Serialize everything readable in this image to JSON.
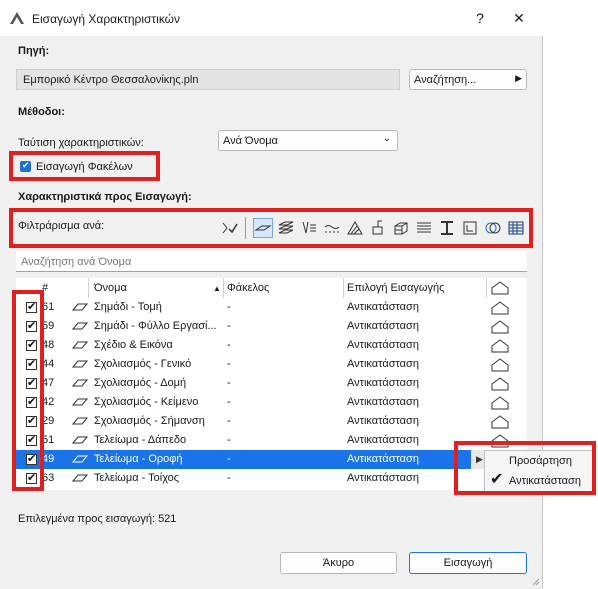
{
  "window": {
    "title": "Εισαγωγή Χαρακτηριστικών",
    "help": "?",
    "close": "✕"
  },
  "source": {
    "label": "Πηγή:",
    "file": "Εμπορικό Κέντρο Θεσσαλονίκης.pln",
    "browse_label": "Αναζήτηση..."
  },
  "methods": {
    "label": "Μέθοδοι:",
    "match_label": "Ταύτιση χαρακτηριστικών:",
    "match_value": "Ανά Όνομα",
    "import_folders_label": "Εισαγωγή Φακέλων",
    "import_folders_checked": true
  },
  "attributes": {
    "label": "Χαρακτηριστικά προς Εισαγωγή:",
    "filter_label": "Φιλτράρισμα ανά:",
    "filter_icons": [
      "select-all-filter-icon",
      "layers-icon",
      "layer-combinations-icon",
      "pens-icon",
      "line-types-icon",
      "fill-types-icon",
      "composites-icon",
      "building-materials-icon",
      "surfaces-icon",
      "profiles-icon",
      "zone-categories-icon",
      "mep-systems-icon",
      "operation-profiles-icon"
    ],
    "search_placeholder": "Αναζήτηση ανά Όνομα",
    "columns": {
      "num": "#",
      "name": "Όνομα",
      "folder": "Φάκελος",
      "choice": "Επιλογή Εισαγωγής"
    },
    "rows": [
      {
        "num": "61",
        "name": "Σημάδι - Τομή",
        "folder": "-",
        "choice": "Αντικατάσταση",
        "checked": true
      },
      {
        "num": "59",
        "name": "Σημάδι - Φύλλο Εργασί...",
        "folder": "-",
        "choice": "Αντικατάσταση",
        "checked": true
      },
      {
        "num": "48",
        "name": "Σχέδιο & Εικόνα",
        "folder": "-",
        "choice": "Αντικατάσταση",
        "checked": true
      },
      {
        "num": "44",
        "name": "Σχολιασμός - Γενικό",
        "folder": "-",
        "choice": "Αντικατάσταση",
        "checked": true
      },
      {
        "num": "47",
        "name": "Σχολιασμός - Δομή",
        "folder": "-",
        "choice": "Αντικατάσταση",
        "checked": true
      },
      {
        "num": "42",
        "name": "Σχολιασμός - Κείμενο",
        "folder": "-",
        "choice": "Αντικατάσταση",
        "checked": true
      },
      {
        "num": "29",
        "name": "Σχολιασμός - Σήμανση",
        "folder": "-",
        "choice": "Αντικατάσταση",
        "checked": true
      },
      {
        "num": "51",
        "name": "Τελείωμα - Δάπεδο",
        "folder": "-",
        "choice": "Αντικατάσταση",
        "checked": true
      },
      {
        "num": "49",
        "name": "Τελείωμα - Οροφή",
        "folder": "-",
        "choice": "Αντικατάσταση",
        "checked": true,
        "selected": true
      },
      {
        "num": "63",
        "name": "Τελείωμα - Τοίχος",
        "folder": "-",
        "choice": "Αντικατάσταση",
        "checked": true
      }
    ],
    "selected_count_label": "Επιλεγμένα προς εισαγωγή: 521"
  },
  "context_menu": {
    "items": [
      {
        "label": "Προσάρτηση",
        "checked": false
      },
      {
        "label": "Αντικατάσταση",
        "checked": true
      }
    ]
  },
  "footer": {
    "cancel_label": "Άκυρο",
    "import_label": "Εισαγωγή"
  },
  "colors": {
    "selection": "#1a73e8",
    "highlight_box": "#e02020",
    "checkbox_accent": "#1e6fd6"
  }
}
